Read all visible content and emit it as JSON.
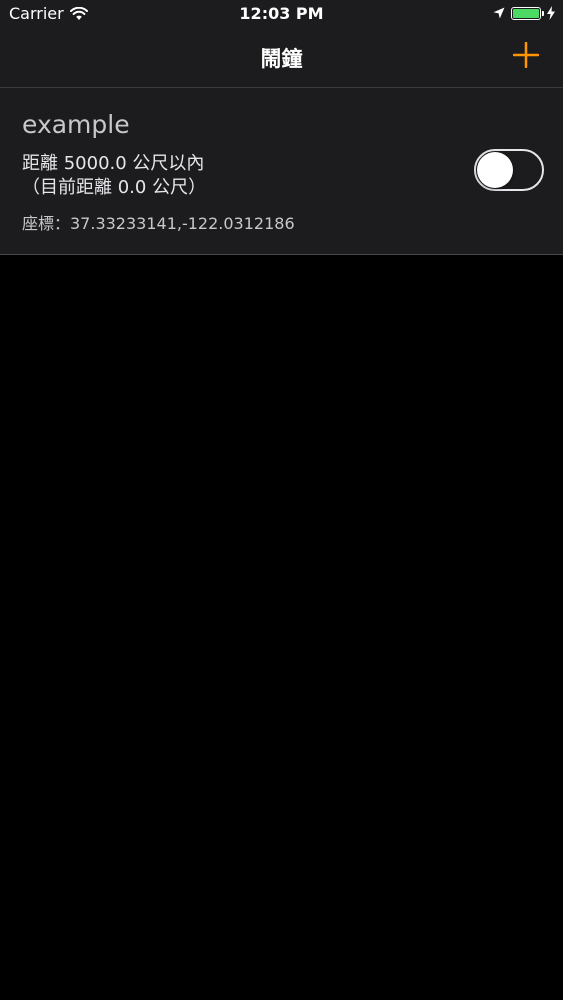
{
  "status_bar": {
    "carrier": "Carrier",
    "time": "12:03 PM",
    "battery_level_percent": 100,
    "battery_color": "#4cd964",
    "icons": [
      "wifi-icon",
      "location-arrow-icon",
      "battery-icon",
      "charging-bolt-icon"
    ]
  },
  "nav": {
    "title": "鬧鐘",
    "add_icon": "plus-icon",
    "accent_color": "#ff9500"
  },
  "alarms": [
    {
      "name": "example",
      "range_line1": "距離 5000.0 公尺以內",
      "range_line2": "（目前距離 0.0 公尺）",
      "coords": "座標：37.33233141,-122.0312186",
      "enabled": false
    }
  ]
}
